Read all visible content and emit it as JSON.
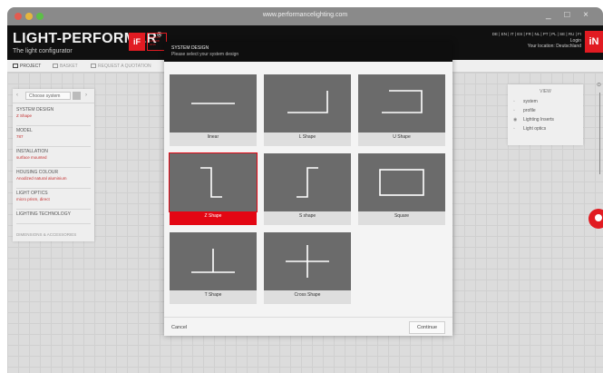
{
  "window": {
    "url": "www.performancelighting.com",
    "controls": "_ □ ×"
  },
  "header": {
    "brand": "LIGHT-PERFORMER",
    "brand_mark": "®",
    "subtitle": "The light configurator",
    "award_logo": "iF",
    "award_text": "DESIGN AWARD 2016",
    "languages": "DE | EN | IT | ES | FR | NL | PT | PL | SE | RU | FI",
    "login": "Login",
    "location": "Your location: Deutschland",
    "logo": "iN"
  },
  "toolbar": {
    "items": [
      "PROJECT",
      "BASKET",
      "REQUEST A QUOTATION"
    ]
  },
  "left_panel": {
    "selector_label": "Choose system",
    "rows": [
      {
        "title": "SYSTEM DESIGN",
        "value": "Z Shape"
      },
      {
        "title": "MODEL",
        "value": "787"
      },
      {
        "title": "INSTALLATION",
        "value": "surface mounted"
      },
      {
        "title": "HOUSING COLOUR",
        "value": "Anodized natural aluminium"
      },
      {
        "title": "LIGHT OPTICS",
        "value": "micro prism, direct"
      },
      {
        "title": "LIGHTING TECHNOLOGY",
        "value": ""
      }
    ],
    "footer": "DIMENSIONS & ACCESSORIES"
  },
  "view_panel": {
    "title": "VIEW",
    "items": [
      "system",
      "profile",
      "Lighting Inserts",
      "Light optics"
    ]
  },
  "modal": {
    "title": "SYSTEM DESIGN",
    "subtitle": "Please select your system design",
    "shapes": [
      {
        "label": "linear",
        "icon": "line-shape-icon",
        "selected": false
      },
      {
        "label": "L Shape",
        "icon": "l-shape-icon",
        "selected": false
      },
      {
        "label": "U Shape",
        "icon": "u-shape-icon",
        "selected": false
      },
      {
        "label": "Z Shape",
        "icon": "z-shape-icon",
        "selected": true
      },
      {
        "label": "S shape",
        "icon": "s-shape-icon",
        "selected": false
      },
      {
        "label": "Square",
        "icon": "square-shape-icon",
        "selected": false
      },
      {
        "label": "T Shape",
        "icon": "t-shape-icon",
        "selected": false
      },
      {
        "label": "Cross Shape",
        "icon": "cross-shape-icon",
        "selected": false
      }
    ],
    "cancel": "Cancel",
    "continue": "Continue"
  },
  "colors": {
    "accent": "#e30613",
    "header_bg": "#0e0e0e",
    "card_image_bg": "#6b6b6b"
  }
}
